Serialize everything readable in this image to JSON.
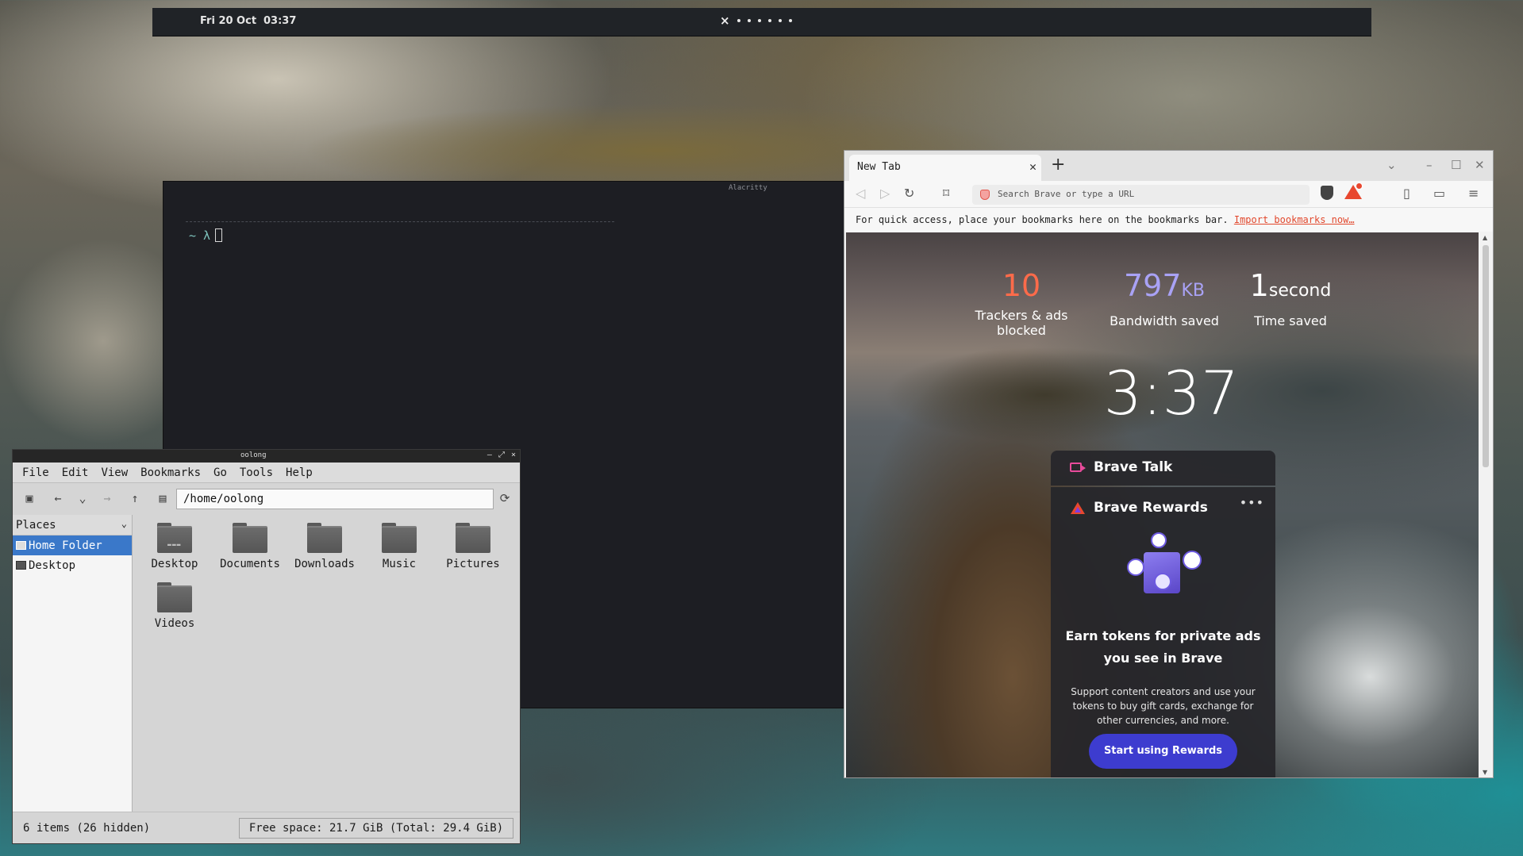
{
  "topbar": {
    "date": "Fri 20 Oct",
    "time": "03:37",
    "workspace_close": "×",
    "workspace_count": 7
  },
  "terminal": {
    "title": "Alacritty",
    "prompt": "~ λ"
  },
  "file_manager": {
    "title": "oolong",
    "window_controls": "– ⤢ ×",
    "menu": [
      "File",
      "Edit",
      "View",
      "Bookmarks",
      "Go",
      "Tools",
      "Help"
    ],
    "path": "/home/oolong",
    "places_label": "Places",
    "places": [
      {
        "label": "Home Folder",
        "active": true
      },
      {
        "label": "Desktop",
        "active": false
      }
    ],
    "folders": [
      "Desktop",
      "Documents",
      "Downloads",
      "Music",
      "Pictures",
      "Videos"
    ],
    "status_items": "6 items (26 hidden)",
    "status_space": "Free space: 21.7 GiB (Total: 29.4 GiB)"
  },
  "browser": {
    "tab_title": "New Tab",
    "url_placeholder": "Search Brave or type a URL",
    "bookmark_hint": "For quick access, place your bookmarks here on the bookmarks bar.",
    "bookmark_link": "Import bookmarks now…",
    "rewards_badge_count": 1,
    "stats": {
      "trackers_value": "10",
      "trackers_label": "Trackers & ads blocked",
      "bandwidth_value": "797",
      "bandwidth_unit": "KB",
      "bandwidth_label": "Bandwidth saved",
      "time_value": "1",
      "time_unit": "second",
      "time_label": "Time saved"
    },
    "clock": "3:37",
    "talk_title": "Brave Talk",
    "rewards": {
      "title": "Brave Rewards",
      "more": "•••",
      "headline": "Earn tokens for private ads you see in Brave",
      "description": "Support content creators and use your tokens to buy gift cards, exchange for other currencies, and more.",
      "button": "Start using Rewards"
    },
    "colors": {
      "trackers": "#ff6b4a",
      "bandwidth": "#a9a2f5",
      "rewards_button": "#3d3ccf",
      "link": "#e2482d"
    }
  }
}
